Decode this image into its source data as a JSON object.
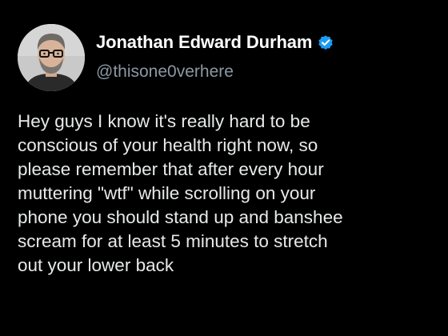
{
  "author": {
    "display_name": "Jonathan Edward Durham",
    "handle": "@thisone0verhere",
    "verified": true,
    "avatar_icon": "profile-photo",
    "verified_icon": "verified-badge-icon",
    "verified_color": "#1d9bf0"
  },
  "tweet": {
    "text_lines": [
      "Hey guys I know it's really hard to be",
      "conscious of your health right now, so",
      "please remember that after every hour",
      "muttering \"wtf\" while scrolling on your",
      "phone you should stand up and banshee",
      "scream for at least 5 minutes to stretch",
      "out your lower back"
    ]
  },
  "colors": {
    "background": "#000000",
    "name": "#ffffff",
    "handle": "#8b98a5",
    "text": "#e7e9ea"
  }
}
